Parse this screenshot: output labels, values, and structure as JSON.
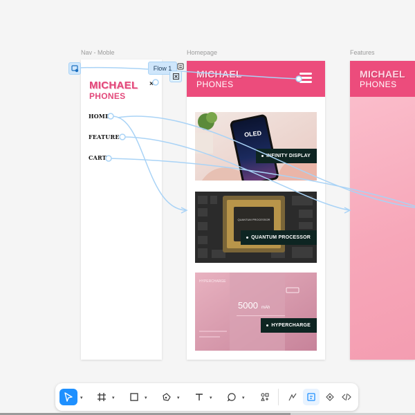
{
  "frames": {
    "nav_label": "Nav - Moble",
    "home_label": "Homepage",
    "features_label": "Features"
  },
  "brand": {
    "line1": "MICHAEL",
    "line2": "PHONES"
  },
  "nav": {
    "close_glyph": "×",
    "links": [
      "HOME",
      "FEATURES",
      "CART"
    ]
  },
  "home": {
    "cards": [
      {
        "screen_title": "OLED",
        "badge": "INFINITY DISPLAY"
      },
      {
        "chip_text": "QUANTUM PROCESSOR",
        "badge": "QUANTUM PROCESSOR"
      },
      {
        "big_number": "5000",
        "big_unit": "mAh",
        "header_text": "HYPERCHARGE",
        "badge": "HYPERCHARGE"
      }
    ]
  },
  "flow": {
    "label": "Flow 1"
  },
  "colors": {
    "brand_pink": "#ec4c7c",
    "flow_blue": "#a9d3f6",
    "badge_dark": "#0e2522"
  },
  "toolbar": {
    "tools": [
      "move-tool",
      "frame-tool",
      "rectangle-tool",
      "pen-tool",
      "text-tool",
      "comment-tool",
      "actions-tool"
    ],
    "right_tools": [
      "draw-mode",
      "design-mode",
      "prototype-mode",
      "dev-mode"
    ]
  }
}
